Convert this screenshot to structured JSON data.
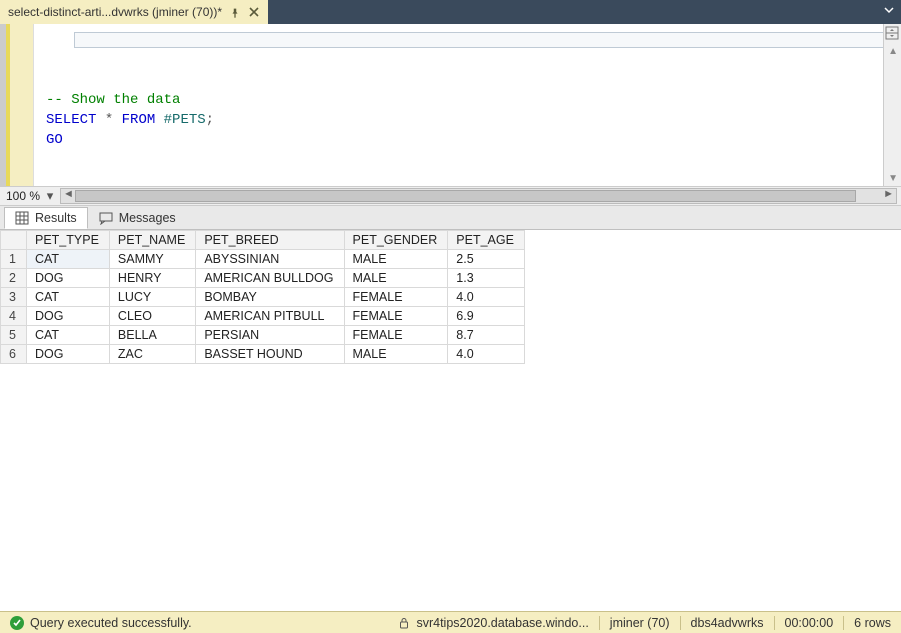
{
  "tab": {
    "title": "select-distinct-arti...dvwrks (jminer (70))*"
  },
  "editor": {
    "zoom": "100 %",
    "lines": {
      "comment": "-- Show the data",
      "stmt_select": "SELECT",
      "stmt_star": "*",
      "stmt_from": "FROM",
      "stmt_table": "#PETS",
      "stmt_semi": ";",
      "go": "GO"
    }
  },
  "result_tabs": {
    "results": "Results",
    "messages": "Messages"
  },
  "grid": {
    "columns": [
      "PET_TYPE",
      "PET_NAME",
      "PET_BREED",
      "PET_GENDER",
      "PET_AGE"
    ],
    "rows": [
      {
        "n": "1",
        "PET_TYPE": "CAT",
        "PET_NAME": "SAMMY",
        "PET_BREED": "ABYSSINIAN",
        "PET_GENDER": "MALE",
        "PET_AGE": "2.5"
      },
      {
        "n": "2",
        "PET_TYPE": "DOG",
        "PET_NAME": "HENRY",
        "PET_BREED": "AMERICAN BULLDOG",
        "PET_GENDER": "MALE",
        "PET_AGE": "1.3"
      },
      {
        "n": "3",
        "PET_TYPE": "CAT",
        "PET_NAME": "LUCY",
        "PET_BREED": "BOMBAY",
        "PET_GENDER": "FEMALE",
        "PET_AGE": "4.0"
      },
      {
        "n": "4",
        "PET_TYPE": "DOG",
        "PET_NAME": "CLEO",
        "PET_BREED": "AMERICAN PITBULL",
        "PET_GENDER": "FEMALE",
        "PET_AGE": "6.9"
      },
      {
        "n": "5",
        "PET_TYPE": "CAT",
        "PET_NAME": "BELLA",
        "PET_BREED": "PERSIAN",
        "PET_GENDER": "FEMALE",
        "PET_AGE": "8.7"
      },
      {
        "n": "6",
        "PET_TYPE": "DOG",
        "PET_NAME": "ZAC",
        "PET_BREED": "BASSET HOUND",
        "PET_GENDER": "MALE",
        "PET_AGE": "4.0"
      }
    ]
  },
  "status": {
    "message": "Query executed successfully.",
    "server": "svr4tips2020.database.windo...",
    "user": "jminer (70)",
    "db": "dbs4advwrks",
    "elapsed": "00:00:00",
    "rows": "6 rows"
  }
}
